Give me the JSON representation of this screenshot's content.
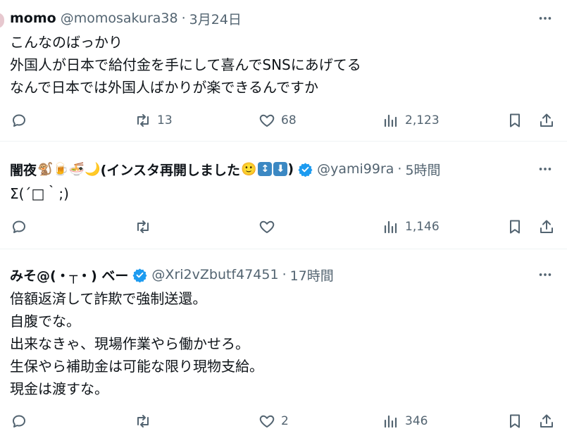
{
  "tweets": [
    {
      "name": "momo",
      "name_emoji": "",
      "handle": "@momosakura38",
      "time": "3月24日",
      "verified": false,
      "body": [
        "こんなのばっかり",
        "外国人が日本で給付金を手にして喜んでSNSにあげてる",
        "なんで日本では外国人ばかりが楽できるんですか"
      ],
      "reply_count": "",
      "retweet_count": "13",
      "like_count": "68",
      "view_count": "2,123"
    },
    {
      "name": "闇夜",
      "name_emoji": "🐒🍺🍜🌙",
      "name_suffix": "(インスタ再開しました",
      "name_emoji2": "🙂",
      "badge1": "↕",
      "badge2": "⬇",
      "name_close": ")",
      "handle": "@yami99ra",
      "time": "5時間",
      "verified": true,
      "body": [
        "Σ(´□｀;)"
      ],
      "reply_count": "",
      "retweet_count": "",
      "like_count": "",
      "view_count": "1,146"
    },
    {
      "name": "みそ@(・┬・) ベー",
      "name_emoji": "",
      "handle": "@Xri2vZbutf47451",
      "time": "17時間",
      "verified": true,
      "body": [
        "倍額返済して詐欺で強制送還。",
        "自腹でな。",
        "出来なきゃ、現場作業やら働かせろ。",
        "生保やら補助金は可能な限り現物支給。",
        "現金は渡すな。"
      ],
      "reply_count": "",
      "retweet_count": "",
      "like_count": "2",
      "view_count": "346"
    }
  ],
  "colors": {
    "text": "#0f1419",
    "secondary": "#536471",
    "verified": "#1d9bf0",
    "divider": "#eff3f4"
  },
  "icons": [
    "reply-icon",
    "retweet-icon",
    "like-icon",
    "views-icon",
    "bookmark-icon",
    "share-icon",
    "more-icon",
    "verified-badge-icon"
  ]
}
